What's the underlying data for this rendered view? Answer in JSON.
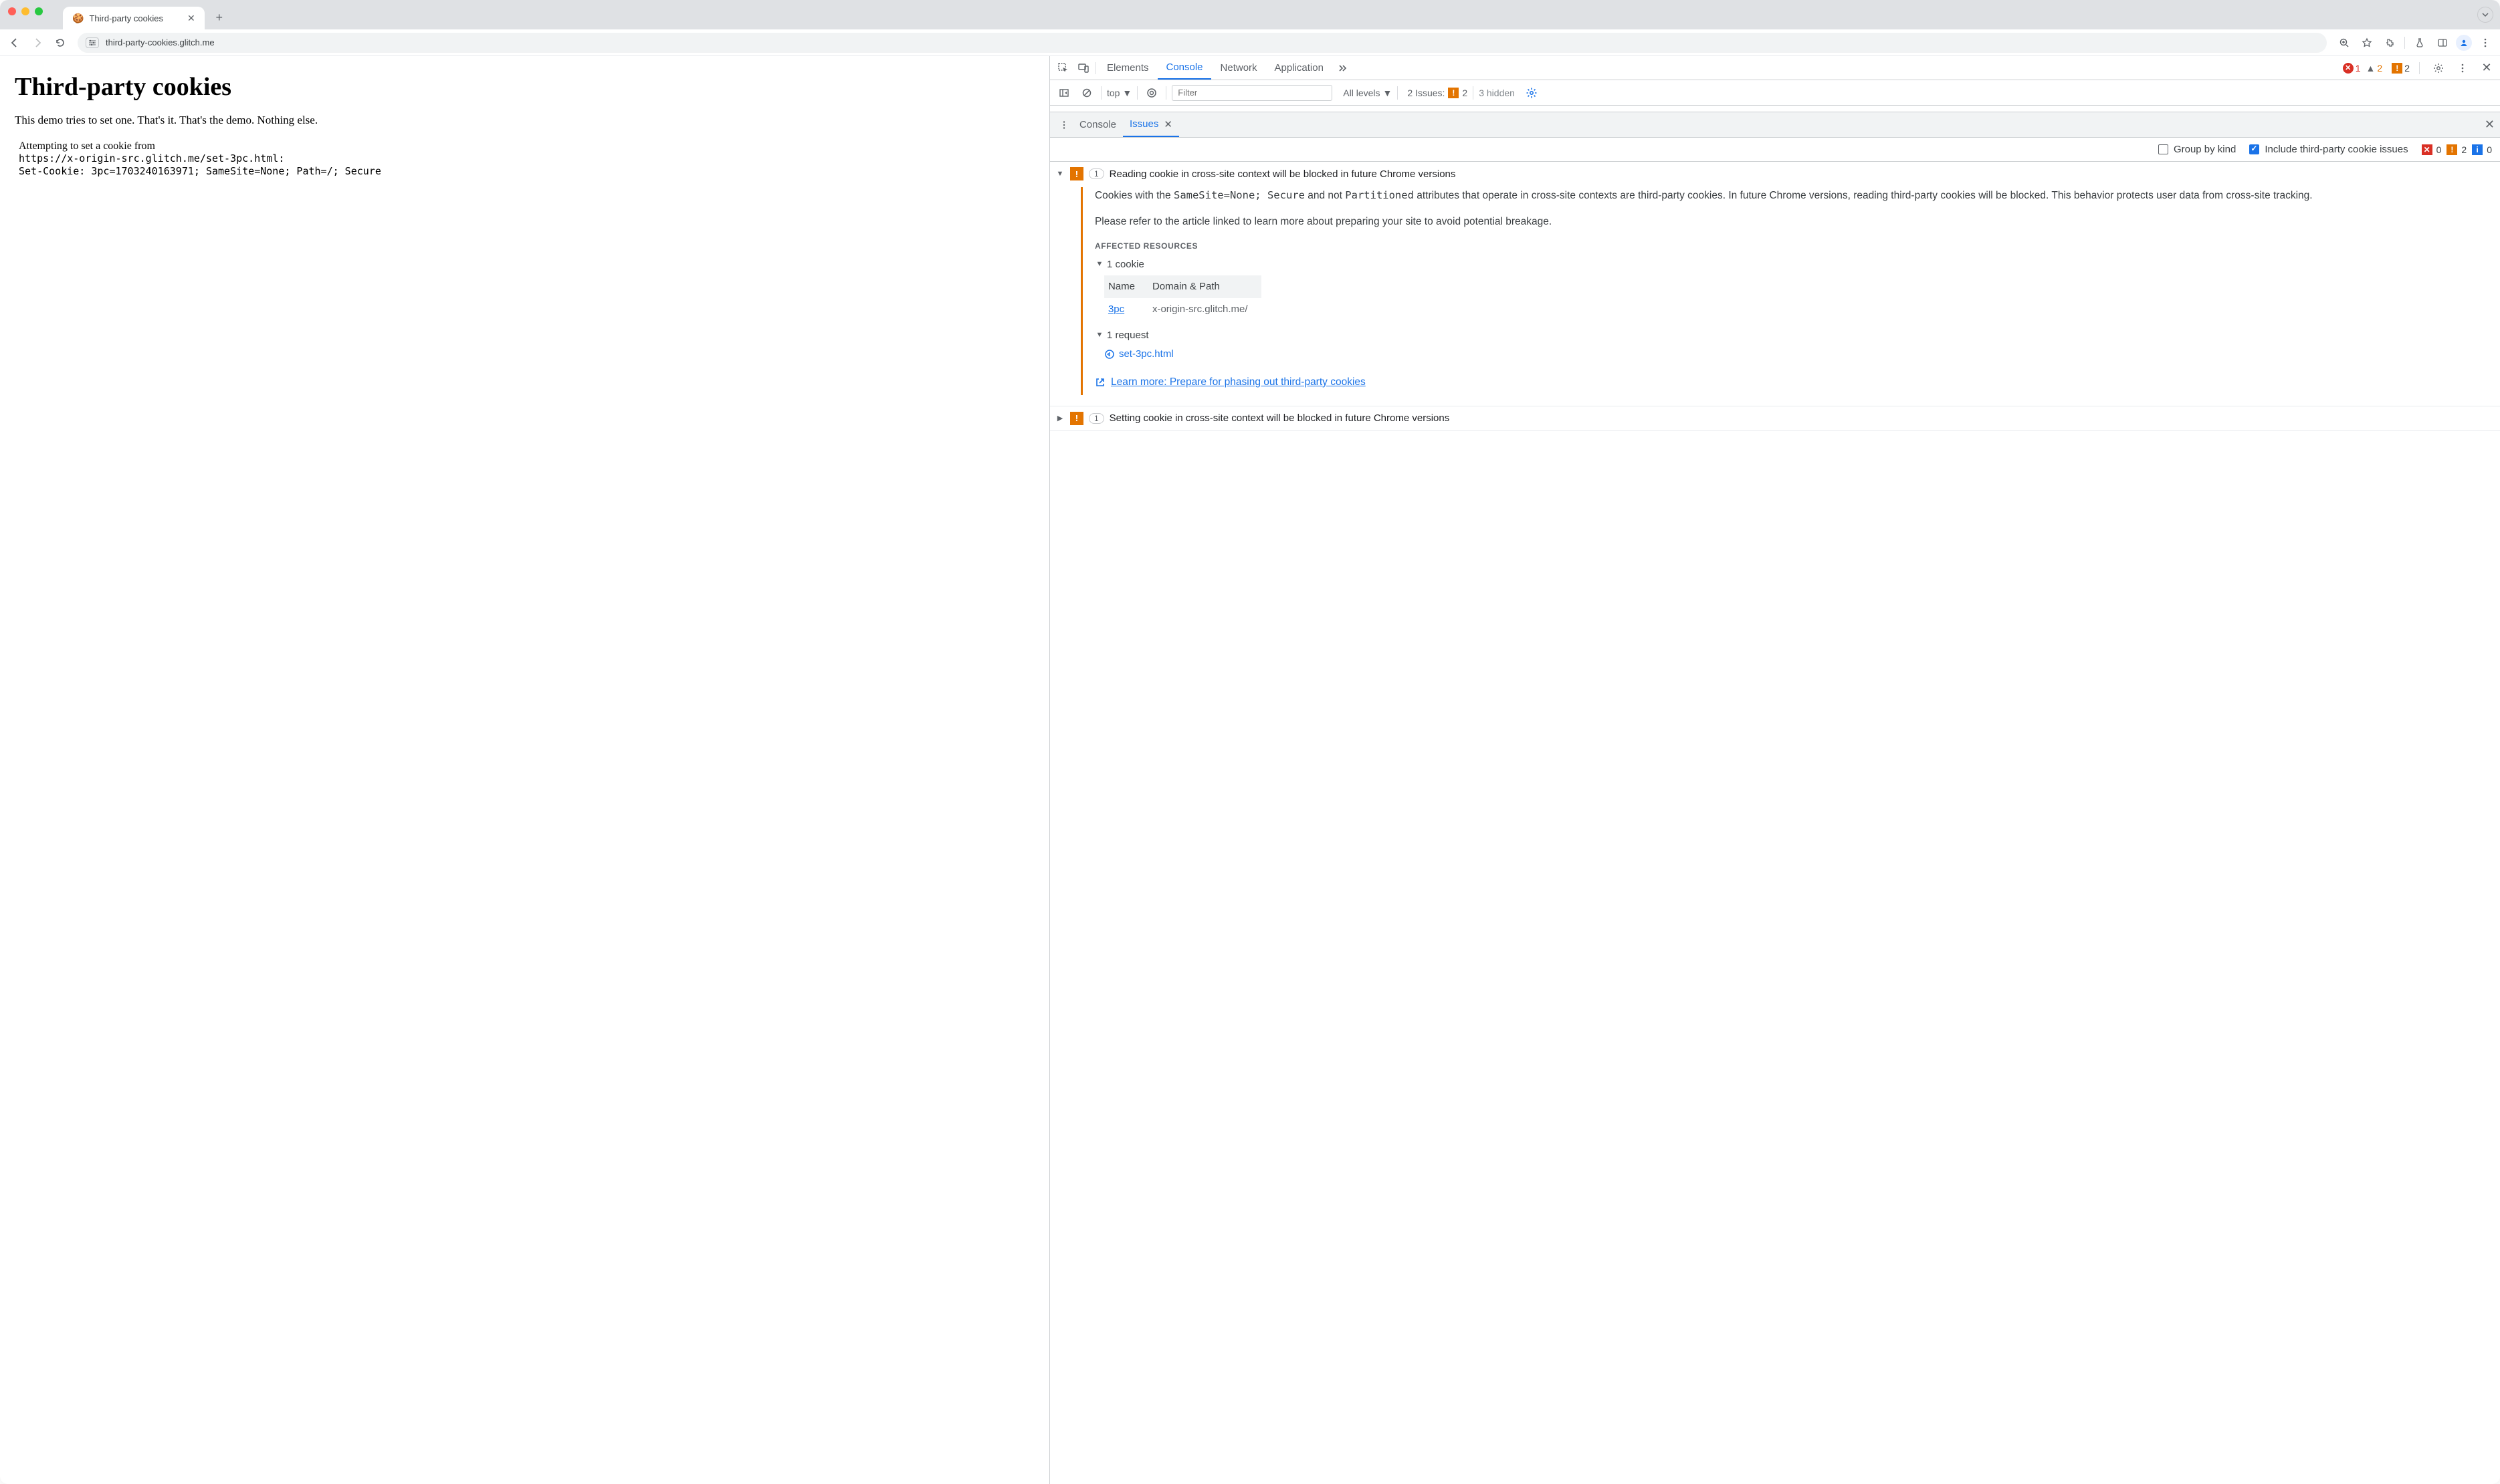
{
  "chrome": {
    "tab_title": "Third-party cookies",
    "url": "third-party-cookies.glitch.me"
  },
  "page": {
    "heading": "Third-party cookies",
    "blurb": "This demo tries to set one. That's it. That's the demo. Nothing else.",
    "log_line1": "Attempting to set a cookie from",
    "log_line2": "https://x-origin-src.glitch.me/set-3pc.html:",
    "log_line3": "Set-Cookie: 3pc=1703240163971; SameSite=None; Path=/; Secure"
  },
  "devtools": {
    "tabs": {
      "elements": "Elements",
      "console": "Console",
      "network": "Network",
      "application": "Application"
    },
    "top_indicators": {
      "errors": "1",
      "warnings": "2",
      "issues": "2"
    },
    "console_toolbar": {
      "context": "top",
      "filter_placeholder": "Filter",
      "levels": "All levels",
      "issues_label": "2 Issues:",
      "issues_count": "2",
      "hidden": "3 hidden"
    },
    "drawer": {
      "console_tab": "Console",
      "issues_tab": "Issues"
    },
    "issues_filter": {
      "group_label": "Group by kind",
      "include_label": "Include third-party cookie issues",
      "counts": {
        "red": "0",
        "orange": "2",
        "blue": "0"
      }
    },
    "issue_expanded": {
      "count": "1",
      "title": "Reading cookie in cross-site context will be blocked in future Chrome versions",
      "para1a": "Cookies with the ",
      "code1": "SameSite=None; Secure",
      "para1b": " and not ",
      "code2": "Partitioned",
      "para1c": " attributes that operate in cross-site contexts are third-party cookies. In future Chrome versions, reading third-party cookies will be blocked. This behavior protects user data from cross-site tracking.",
      "para2": "Please refer to the article linked to learn more about preparing your site to avoid potential breakage.",
      "affected_header": "AFFECTED RESOURCES",
      "cookie_group": "1 cookie",
      "table": {
        "h1": "Name",
        "h2": "Domain & Path",
        "name": "3pc",
        "domain": "x-origin-src.glitch.me/"
      },
      "request_group": "1 request",
      "request_name": "set-3pc.html",
      "learn_more": "Learn more: Prepare for phasing out third-party cookies"
    },
    "issue_collapsed": {
      "count": "1",
      "title": "Setting cookie in cross-site context will be blocked in future Chrome versions"
    }
  }
}
